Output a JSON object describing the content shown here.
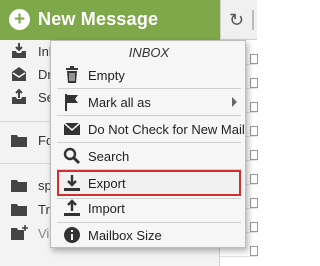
{
  "header": {
    "new_message_label": "New Message",
    "plus_glyph": "+"
  },
  "sidebar": {
    "items": [
      {
        "label": "Inbox",
        "icon": "inbox-tray-icon"
      },
      {
        "label": "Dr",
        "icon": "drafts-envelope-icon"
      },
      {
        "label": "Se",
        "icon": "sent-tray-icon"
      },
      {
        "label": "Fo",
        "icon": "folder-icon"
      },
      {
        "label": "sp",
        "icon": "folder-icon"
      },
      {
        "label": "Tra",
        "icon": "folder-icon"
      },
      {
        "label": "Vir",
        "icon": "add-folder-icon"
      }
    ]
  },
  "context_menu": {
    "title": "INBOX",
    "items": [
      {
        "label": "Empty",
        "icon": "trash-icon"
      },
      {
        "label": "Mark all as",
        "icon": "flag-icon",
        "has_submenu": true
      },
      {
        "label": "Do Not Check for New Mail",
        "icon": "envelope-x-icon"
      },
      {
        "label": "Search",
        "icon": "search-icon"
      },
      {
        "label": "Export",
        "icon": "download-icon",
        "highlighted": true
      },
      {
        "label": "Import",
        "icon": "upload-icon"
      },
      {
        "label": "Mailbox Size",
        "icon": "info-icon"
      }
    ]
  },
  "colors": {
    "header_green": "#7fa84a",
    "highlight_red": "#d32f2f"
  }
}
